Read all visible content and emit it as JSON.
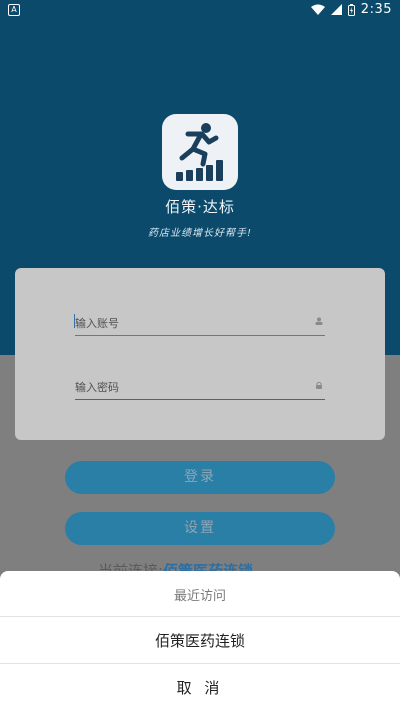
{
  "status_bar": {
    "time": "2:35",
    "left_icon_letter": "A"
  },
  "app": {
    "name": "佰策·达标",
    "slogan": "药店业绩增长好帮手!"
  },
  "login": {
    "account_placeholder": "输入账号",
    "password_placeholder": "输入密码"
  },
  "buttons": {
    "login": "登录",
    "settings": "设置"
  },
  "connection": {
    "label": "当前连接:",
    "value": "佰策医药连锁"
  },
  "sheet": {
    "title": "最近访问",
    "items": [
      "佰策医药连锁"
    ],
    "cancel": "取 消"
  },
  "colors": {
    "header_bg": "#0b4a6a",
    "accent": "#2a7fa6"
  }
}
